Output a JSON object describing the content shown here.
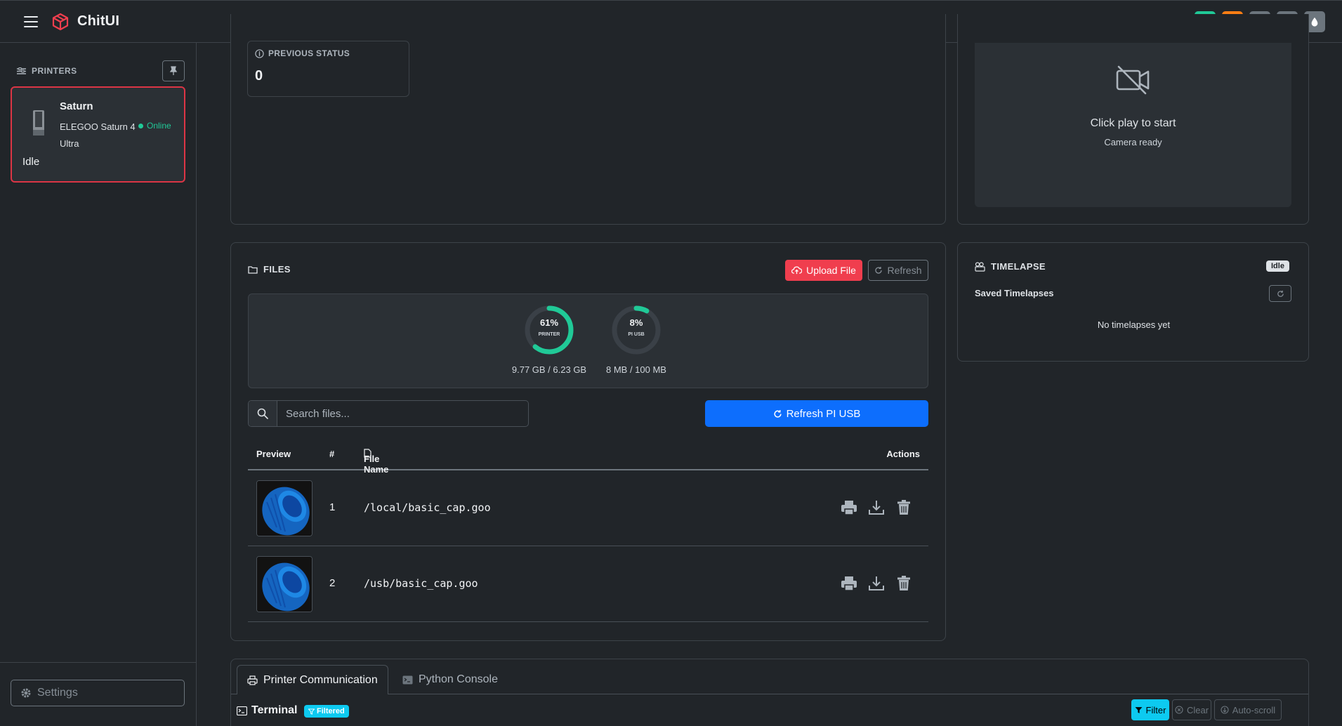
{
  "app": {
    "brand": "ChitUI"
  },
  "top_actions": [
    {
      "icon": "bell-icon",
      "color": "#20c997"
    },
    {
      "icon": "bolt-icon",
      "color": "#fd7e14"
    },
    {
      "icon": "power-icon",
      "color": "#6c757d"
    },
    {
      "icon": "lightbulb-icon",
      "color": "#6c757d"
    },
    {
      "icon": "droplet-icon",
      "color": "#6c757d"
    }
  ],
  "sidebar": {
    "header": "PRINTERS",
    "printer": {
      "name": "Saturn",
      "model": "ELEGOO Saturn 4 Ultra",
      "connection": "Online",
      "status": "Idle"
    },
    "settings_label": "Settings"
  },
  "previous_status": {
    "label": "PREVIOUS STATUS",
    "value": "0"
  },
  "camera": {
    "title": "Click play to start",
    "subtitle": "Camera ready"
  },
  "files": {
    "title": "FILES",
    "upload_label": "Upload File",
    "refresh_label": "Refresh",
    "storage": [
      {
        "percent_text": "61%",
        "percent": 61,
        "label": "PRINTER",
        "caption": "9.77 GB / 6.23 GB",
        "color": "#20c997"
      },
      {
        "percent_text": "8%",
        "percent": 8,
        "label": "PI USB",
        "caption": "8 MB / 100 MB",
        "color": "#20c997"
      }
    ],
    "search_placeholder": "Search files...",
    "refresh_usb_label": "Refresh PI USB",
    "columns": {
      "preview": "Preview",
      "num": "#",
      "name": "File Name",
      "actions": "Actions"
    },
    "rows": [
      {
        "num": "1",
        "name": "/local/basic_cap.goo"
      },
      {
        "num": "2",
        "name": "/usb/basic_cap.goo"
      }
    ]
  },
  "timelapse": {
    "title": "TIMELAPSE",
    "badge": "Idle",
    "saved_label": "Saved Timelapses",
    "empty_text": "No timelapses yet"
  },
  "bottom": {
    "tabs": [
      {
        "label": "Printer Communication",
        "active": true
      },
      {
        "label": "Python Console",
        "active": false
      }
    ],
    "terminal_label": "Terminal",
    "filtered_badge": "Filtered",
    "filter_label": "Filter",
    "clear_label": "Clear",
    "autoscroll_label": "Auto-scroll"
  }
}
